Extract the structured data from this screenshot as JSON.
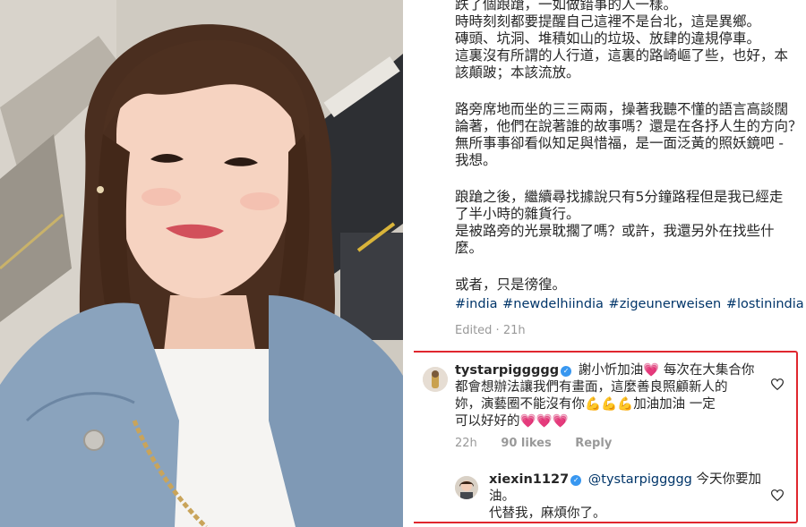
{
  "caption": {
    "lines": [
      "跌了個踉蹌，一如做錯事的人一樣。",
      "時時刻刻都要提醒自己這裡不是台北，這是異鄉。",
      "磚頭、坑洞、堆積如山的垃圾、放肆的違規停車。",
      "這裏沒有所謂的人行道，這裏的路崎嶇了些，也好，本",
      "該顛跛；本該流放。",
      "",
      "路旁席地而坐的三三兩兩，操著我聽不懂的語言高談闊",
      "論著，他們在說著誰的故事嗎？還是在各抒人生的方向？",
      "無所事事卻看似知足與惜福，是一面泛黃的照妖鏡吧 -",
      "我想。",
      "",
      "踉蹌之後，繼續尋找據說只有5分鐘路程但是我已經走",
      "了半小時的雜貨行。",
      "是被路旁的光景耽擱了嗎？或許，我還另外在找些什",
      "麼。",
      "",
      "或者，只是徬徨。"
    ],
    "hashtags": [
      "#india",
      "#newdelhiindia",
      "#zigeunerweisen",
      "#lostinindia"
    ],
    "edited": "Edited · 21h"
  },
  "comments": [
    {
      "username": "tystarpiggggg",
      "line1": "謝小忻加油",
      "line1_tail": "每次在大集合你",
      "line2": "都會想辦法讓我們有畫面，這麼善良照顧新人的",
      "line3": "妳，演藝圈不能沒有你",
      "line3_tail": "加油加油 一定",
      "line4": "可以好好的",
      "time": "22h",
      "likes": "90 likes",
      "reply": "Reply",
      "icons": {
        "heart_emoji": "💗",
        "arm_emoji": "💪"
      }
    },
    {
      "username": "xiexin1127",
      "mention": "@tystarpiggggg",
      "line1_tail": "今天你要加",
      "line2": "油。",
      "line3": "代替我，麻煩你了。"
    }
  ],
  "colors": {
    "highlight_border": "#e0262e",
    "hashtag": "#003569",
    "verified": "#3897f0",
    "muted": "#999999"
  }
}
